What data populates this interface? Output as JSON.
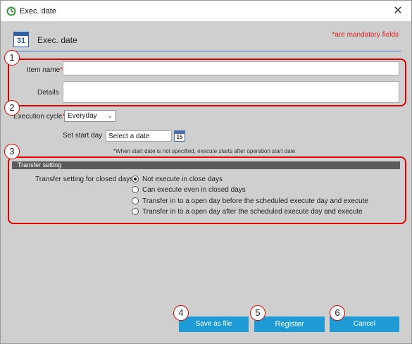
{
  "window": {
    "title": "Exec. date",
    "close_glyph": "✕"
  },
  "header": {
    "icon_number": "31",
    "title": "Exec. date",
    "mandatory_note": "*are mandatory fields"
  },
  "callouts": [
    "1",
    "2",
    "3",
    "4",
    "5",
    "6"
  ],
  "form": {
    "item_name_label": "Item name",
    "details_label": "Details",
    "required_mark": "*",
    "execution_cycle_label": "Execution cycle",
    "execution_cycle_value": "Everyday",
    "set_start_day_label": "Set start day",
    "start_day_placeholder": "Select a date",
    "calendar_icon_number": "15",
    "start_date_note": "*When start date is not specified, execute starts after operation start date"
  },
  "transfer": {
    "section_title": "Transfer setting",
    "label": "Transfer setting for closed days",
    "options": [
      {
        "label": "Not execute in close days",
        "checked": true
      },
      {
        "label": "Can execute even in closed days",
        "checked": false
      },
      {
        "label": "Transfer in to a open day before the scheduled execute day and execute",
        "checked": false
      },
      {
        "label": "Transfer in to a open day after the scheduled execute day and execute",
        "checked": false
      }
    ]
  },
  "buttons": {
    "save_as_file": "Save as file",
    "register": "Register",
    "cancel": "Cancel"
  },
  "colors": {
    "accent": "#1e9bd7",
    "mandatory": "#e02020",
    "callout_border": "#e00000",
    "section_header": "#5b5b5b"
  }
}
